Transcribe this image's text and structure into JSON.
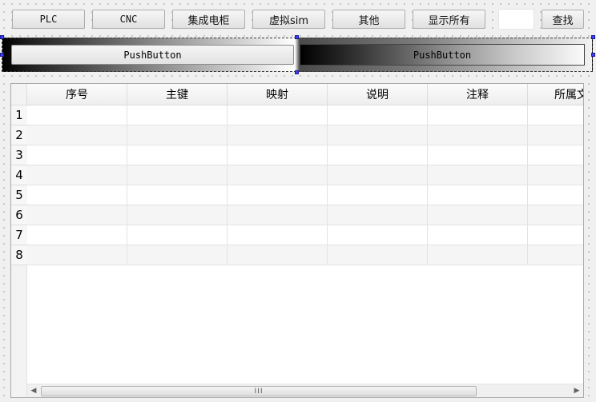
{
  "toolbar": {
    "buttons": [
      "PLC",
      "CNC",
      "集成电柜",
      "虚拟sim",
      "其他",
      "显示所有"
    ],
    "search_value": "",
    "search_button": "查找"
  },
  "push_buttons": [
    "PushButton",
    "PushButton"
  ],
  "table": {
    "columns": [
      "序号",
      "主键",
      "映射",
      "说明",
      "注释",
      "所属文"
    ],
    "row_numbers": [
      "1",
      "2",
      "3",
      "4",
      "5",
      "6",
      "7",
      "8"
    ],
    "scrollbar_grip": "III"
  },
  "icons": {
    "scroll_left": "arrow-left-icon",
    "scroll_right": "arrow-right-icon"
  }
}
